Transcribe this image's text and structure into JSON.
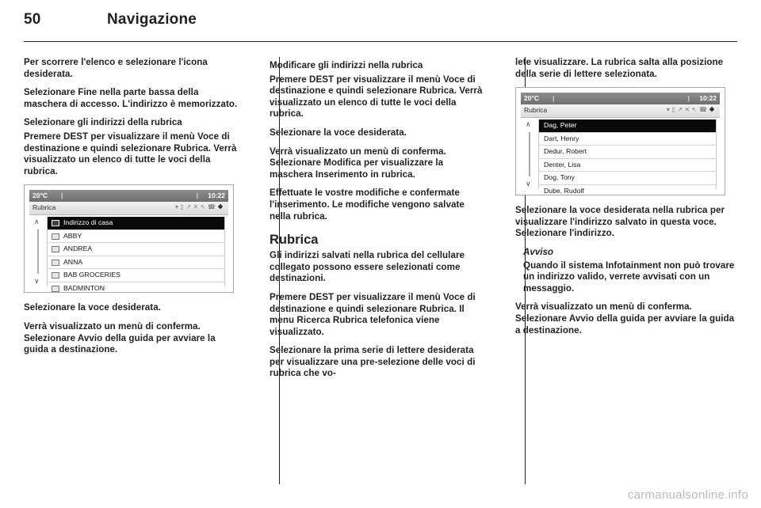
{
  "header": {
    "page_number": "50",
    "title": "Navigazione"
  },
  "column1": {
    "p1": "Per scorrere l'elenco e selezionare l'icona desiderata.",
    "p2": "Selezionare Fine nella parte bassa della maschera di accesso. L'indirizzo è memorizzato.",
    "h_indirizzi": "Selezionare gli indirizzi della rubrica",
    "p3": "Premere DEST per visualizzare il menù Voce di destinazione e quindi selezionare Rubrica. Verrà visualizzato un elenco di tutte le voci della rubrica.",
    "p4": "Selezionare la voce desiderata.",
    "p5": "Verrà visualizzato un menù di conferma. Selezionare Avvio della guida per avviare la guida a destinazione."
  },
  "column2": {
    "h_modificare": "Modificare gli indirizzi nella rubrica",
    "p1": "Premere DEST per visualizzare il menù Voce di destinazione e quindi selezionare Rubrica. Verrà visualizzato un elenco di tutte le voci della rubrica.",
    "p2": "Selezionare la voce desiderata.",
    "p3": "Verrà visualizzato un menù di conferma. Selezionare Modifica per visualizzare la maschera Inserimento in rubrica.",
    "p4": "Effettuate le vostre modifiche e confermate l'inserimento. Le modifiche vengono salvate nella rubrica.",
    "h_rubrica": "Rubrica",
    "p5": "Gli indirizzi salvati nella rubrica del cellulare collegato possono essere selezionati come destinazioni.",
    "p6": "Premere DEST per visualizzare il menù Voce di destinazione e quindi selezionare Rubrica. Il menu Ricerca Rubrica telefonica viene visualizzato.",
    "p7": "Selezionare la prima serie di lettere desiderata per visualizzare una pre-selezione delle voci di rubrica che vo-"
  },
  "column3": {
    "p1": "lete visualizzare. La rubrica salta alla posizione della serie di lettere selezionata.",
    "p2": "Selezionare la voce desiderata nella rubrica per visualizzare l'indirizzo salvato in questa voce. Selezionare l'indirizzo.",
    "note_title": "Avviso",
    "note_body": "Quando il sistema Infotainment non può trovare un indirizzo valido, verrete avvisati con un messaggio.",
    "p3": "Verrà visualizzato un menù di conferma. Selezionare Avvio della guida per avviare la guida a destinazione."
  },
  "screen1": {
    "temperature": "20°C",
    "clock": "10:22",
    "menu_title": "Rubrica",
    "status_icons": [
      "wifi-icon",
      "message-icon",
      "signal-icon",
      "shuffle-icon",
      "mute-icon",
      "phone-icon",
      "battery-icon"
    ],
    "scroll_up": "scroll-up-arrow",
    "scroll_down": "scroll-down-arrow",
    "rows": [
      {
        "label": "Indirizzo di casa",
        "icon": "home-icon",
        "selected": true
      },
      {
        "label": "ABBY",
        "icon": "contact-icon",
        "selected": false
      },
      {
        "label": "ANDREA",
        "icon": "contact-icon",
        "selected": false
      },
      {
        "label": "ANNA",
        "icon": "contact-icon",
        "selected": false
      },
      {
        "label": "BAB GROCERIES",
        "icon": "business-icon",
        "selected": false
      },
      {
        "label": "BADMINTON",
        "icon": "contact-icon",
        "selected": false
      }
    ]
  },
  "screen2": {
    "temperature": "20°C",
    "clock": "10:22",
    "menu_title": "Rubrica",
    "scroll_up": "scroll-up-arrow",
    "scroll_down": "scroll-down-arrow",
    "rows": [
      {
        "label": "Dag, Peter",
        "selected": true
      },
      {
        "label": "Dart, Henry",
        "selected": false
      },
      {
        "label": "Dedur, Robert",
        "selected": false
      },
      {
        "label": "Denter, Lisa",
        "selected": false
      },
      {
        "label": "Dog, Tony",
        "selected": false
      },
      {
        "label": "Dube, Rudolf",
        "selected": false
      }
    ]
  },
  "watermark": "carmanualsonline.info"
}
